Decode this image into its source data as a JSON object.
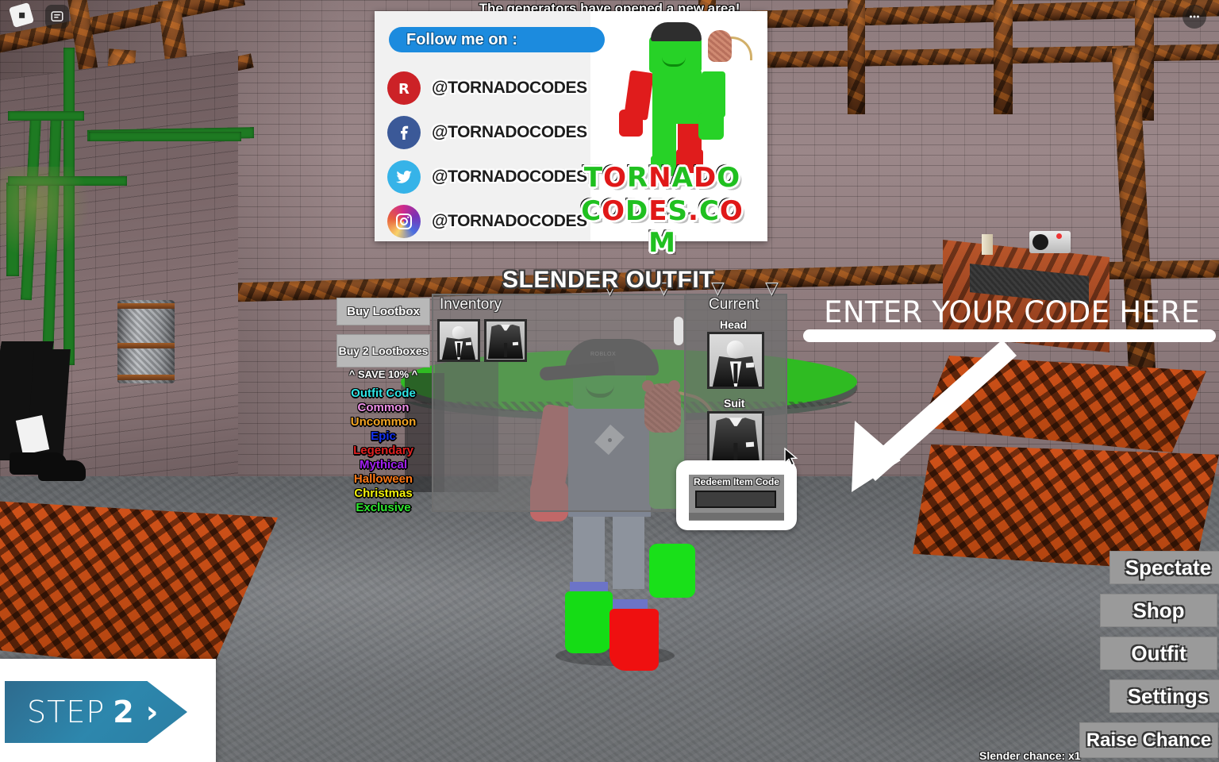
{
  "notification": "The generators have opened a new area!",
  "top_icons": {
    "roblox_logo": "roblox-logo-icon",
    "chat": "chat-icon",
    "more": "more-options-icon"
  },
  "social_panel": {
    "follow_label": "Follow me on :",
    "accounts": [
      {
        "platform": "roblox",
        "glyph": "R",
        "handle": "@TORNADOCODES"
      },
      {
        "platform": "facebook",
        "glyph": "f",
        "handle": "@TORNADOCODES"
      },
      {
        "platform": "twitter",
        "glyph": "ᵗ",
        "handle": "@TORNADOCODES"
      },
      {
        "platform": "instagram",
        "glyph": "◎",
        "handle": "@TORNADOCODES"
      }
    ],
    "logo_line1": "TORNADO",
    "logo_line2": "CODES.COM"
  },
  "outfit_window": {
    "title": "SLENDER OUTFIT",
    "inventory_label": "Inventory",
    "current_label": "Current",
    "head_label": "Head",
    "suit_label": "Suit",
    "inventory_items": [
      "slender-head-thumb",
      "black-suit-thumb"
    ],
    "buttons": {
      "buy_lootbox": "Buy Lootbox",
      "buy_2_lootboxes": "Buy 2 Lootboxes",
      "save_note": "^ SAVE 10% ^"
    },
    "rarities": [
      {
        "label": "Outfit Code",
        "color": "#2ee6e6"
      },
      {
        "label": "Common",
        "color": "#ee8fe8"
      },
      {
        "label": "Uncommon",
        "color": "#f5a623"
      },
      {
        "label": "Epic",
        "color": "#1431f0"
      },
      {
        "label": "Legendary",
        "color": "#e02020"
      },
      {
        "label": "Mythical",
        "color": "#a020f0"
      },
      {
        "label": "Halloween",
        "color": "#ff7a18"
      },
      {
        "label": "Christmas",
        "color": "#f2f20a"
      },
      {
        "label": "Exclusive",
        "color": "#2ee62e"
      }
    ]
  },
  "redeem_popup": {
    "title": "Redeem Item Code",
    "input_value": "",
    "input_placeholder": ""
  },
  "annotation": {
    "text": "ENTER YOUR CODE HERE",
    "underline_color": "#ffffff",
    "arrow": "arrow-pointing-down-left"
  },
  "side_menu": {
    "items": [
      {
        "label": "Spectate"
      },
      {
        "label": "Shop"
      },
      {
        "label": "Outfit"
      },
      {
        "label": "Settings"
      },
      {
        "label": "Raise Chance"
      }
    ]
  },
  "status": {
    "slender_chance": "Slender chance: x1"
  },
  "step_badge": {
    "word": "STEP",
    "number": "2",
    "chevron": "›",
    "accent_color": "#2d87ad"
  }
}
